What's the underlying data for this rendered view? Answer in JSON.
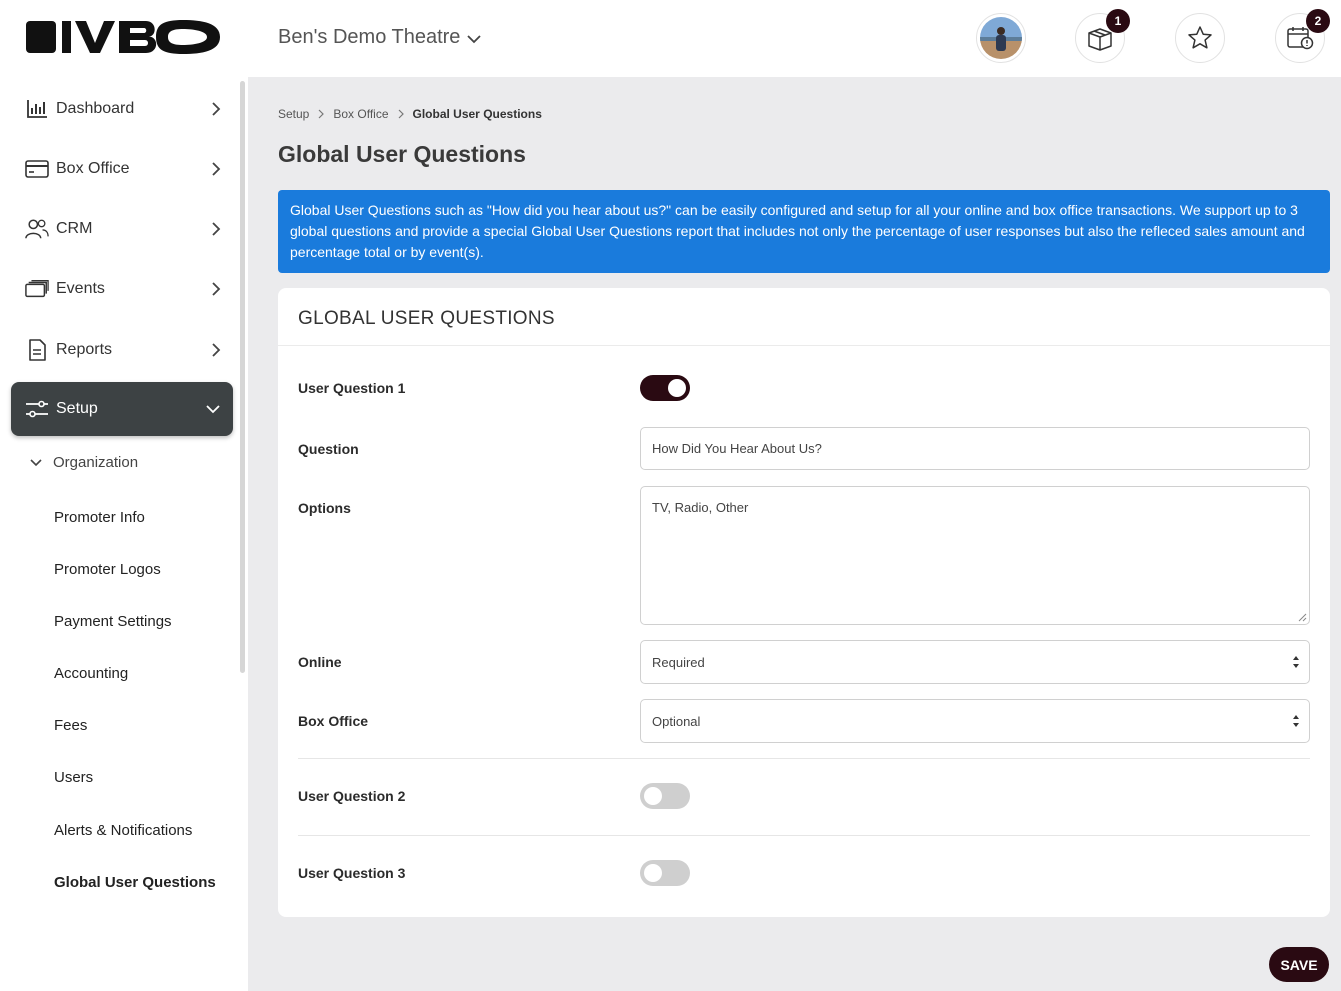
{
  "app": {
    "brand": "VBO",
    "theatre_name": "Ben's Demo Theatre"
  },
  "header": {
    "cart_badge": "1",
    "calendar_badge": "2",
    "colors": {
      "badge": "#2a0a12"
    }
  },
  "sidebar": {
    "items": [
      {
        "label": "Dashboard",
        "icon": "bar-chart-icon"
      },
      {
        "label": "Box Office",
        "icon": "card-icon"
      },
      {
        "label": "CRM",
        "icon": "users-icon"
      },
      {
        "label": "Events",
        "icon": "ticket-icon"
      },
      {
        "label": "Reports",
        "icon": "document-icon"
      },
      {
        "label": "Setup",
        "icon": "sliders-icon",
        "active": true
      }
    ],
    "group_label": "Organization",
    "sub_items": [
      "Promoter Info",
      "Promoter Logos",
      "Payment Settings",
      "Accounting",
      "Fees",
      "Users",
      "Alerts & Notifications",
      "Global User Questions"
    ],
    "active_color": "#3d4244"
  },
  "breadcrumb": {
    "items": [
      "Setup",
      "Box Office",
      "Global User Questions"
    ]
  },
  "page": {
    "title": "Global User Questions",
    "info": "Global User Questions such as \"How did you hear about us?\" can be easily configured and setup for all your online and box office transactions. We support up to 3 global questions and provide a special Global User Questions report that includes not only the percentage of user responses but also the refleced sales amount and percentage total or by event(s).",
    "info_color": "#1a7bdc"
  },
  "card": {
    "title": "GLOBAL USER QUESTIONS",
    "q1_label": "User Question 1",
    "q1_enabled": true,
    "question_label": "Question",
    "question_value": "How Did You Hear About Us?",
    "options_label": "Options",
    "options_value": "TV, Radio, Other",
    "online_label": "Online",
    "online_value": "Required",
    "box_office_label": "Box Office",
    "box_office_value": "Optional",
    "q2_label": "User Question 2",
    "q2_enabled": false,
    "q3_label": "User Question 3",
    "q3_enabled": false
  },
  "actions": {
    "save_label": "SAVE"
  }
}
